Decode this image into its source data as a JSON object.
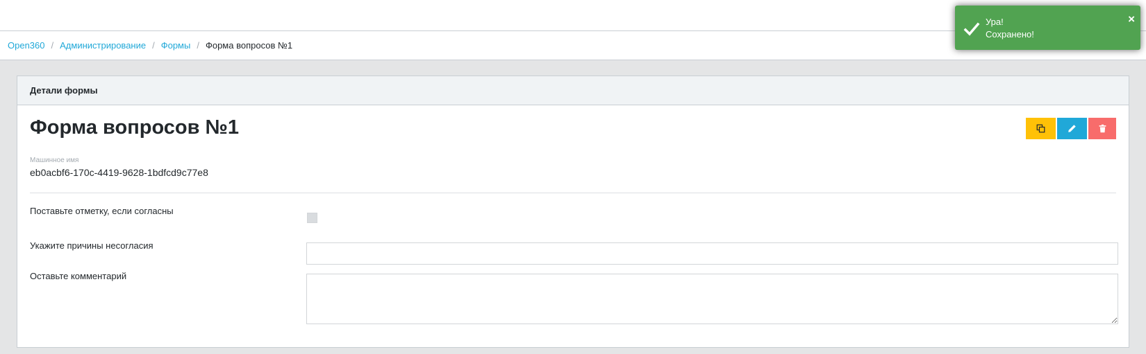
{
  "breadcrumb": {
    "items": [
      "Open360",
      "Администрирование",
      "Формы"
    ],
    "separator": "/",
    "current": "Форма вопросов №1"
  },
  "card": {
    "header": "Детали формы",
    "title": "Форма вопросов №1",
    "machine_name_label": "Машинное имя",
    "machine_name_value": "eb0acbf6-170c-4419-9628-1bdfcd9c77e8"
  },
  "actions": {
    "copy_icon": "copy-icon",
    "edit_icon": "pencil-icon",
    "delete_icon": "trash-icon"
  },
  "fields": {
    "agree_label": "Поставьте отметку, если согласны",
    "agree_checked": false,
    "reason_label": "Укажите причины несогласия",
    "reason_value": "",
    "comment_label": "Оставьте комментарий",
    "comment_value": ""
  },
  "toast": {
    "title": "Ура!",
    "message": "Сохранено!",
    "close": "×",
    "icon": "checkmark-icon"
  },
  "colors": {
    "link": "#20a8d8",
    "copy_button": "#ffc107",
    "edit_button": "#20a8d8",
    "delete_button": "#f86c6b",
    "toast_success": "#51a351"
  }
}
